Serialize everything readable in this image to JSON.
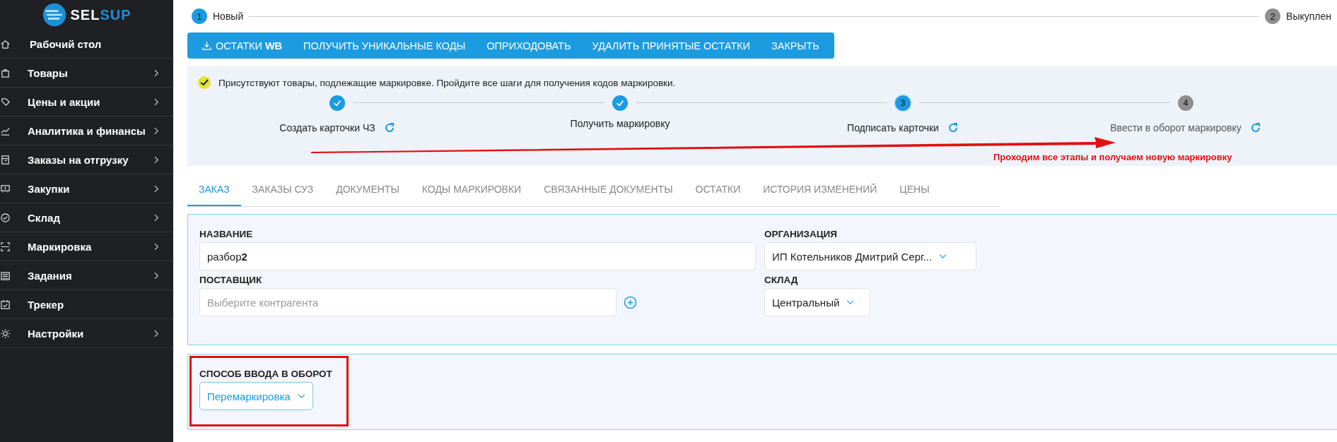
{
  "sidebar": {
    "logo": {
      "text_left": "SEL",
      "text_right": "SUP"
    },
    "items": [
      {
        "label": "Рабочий стол",
        "has_submenu": false
      },
      {
        "label": "Товары",
        "has_submenu": true
      },
      {
        "label": "Цены и акции",
        "has_submenu": true
      },
      {
        "label": "Аналитика и финансы",
        "has_submenu": true
      },
      {
        "label": "Заказы на отгрузку",
        "has_submenu": true
      },
      {
        "label": "Закупки",
        "has_submenu": true
      },
      {
        "label": "Склад",
        "has_submenu": true
      },
      {
        "label": "Маркировка",
        "has_submenu": true
      },
      {
        "label": "Задания",
        "has_submenu": true
      },
      {
        "label": "Трекер",
        "has_submenu": false
      },
      {
        "label": "Настройки",
        "has_submenu": true
      }
    ]
  },
  "status_steps": [
    {
      "number": "1",
      "label": "Новый",
      "selected": true
    },
    {
      "number": "2",
      "label": "Выкуплен",
      "selected": false
    }
  ],
  "toolbar": [
    {
      "label": "ОСТАТКИ **WB**",
      "kind": "download"
    },
    {
      "label": "ПОЛУЧИТЬ УНИКАЛЬНЫЕ КОДЫ",
      "kind": "text"
    },
    {
      "label": "ОПРИХОДОВАТЬ",
      "kind": "text"
    },
    {
      "label": "УДАЛИТЬ ПРИНЯТЫЕ ОСТАТКИ",
      "kind": "text"
    },
    {
      "label": "ЗАКРЫТЬ",
      "kind": "text"
    }
  ],
  "marking": {
    "notice": "Присутствуют товары, подлежащие маркировке. Пройдите все шаги для получения кодов маркировки.",
    "steps": [
      {
        "label": "Создать карточки ЧЗ",
        "completed": true,
        "selected": false,
        "refresh": true
      },
      {
        "label": "Получить маркировку",
        "completed": true,
        "selected": false,
        "refresh": false
      },
      {
        "number": "3",
        "label": "Подписать карточки",
        "completed": false,
        "selected": true,
        "refresh": true
      },
      {
        "number": "4",
        "label": "Ввести в оборот маркировку",
        "completed": false,
        "selected": false,
        "refresh": true
      }
    ]
  },
  "annotation": {
    "text": "Проходим все этапы и получаем новую маркировку"
  },
  "tabs": [
    {
      "label": "ЗАКАЗ",
      "selected": true
    },
    {
      "label": "ЗАКАЗЫ СУЗ",
      "selected": false
    },
    {
      "label": "ДОКУМЕНТЫ",
      "selected": false
    },
    {
      "label": "КОДЫ МАРКИРОВКИ",
      "selected": false
    },
    {
      "label": "СВЯЗАННЫЕ ДОКУМЕНТЫ",
      "selected": false
    },
    {
      "label": "ОСТАТКИ",
      "selected": false
    },
    {
      "label": "ИСТОРИЯ ИЗМЕНЕНИЙ",
      "selected": false
    },
    {
      "label": "ЦЕНЫ",
      "selected": false
    }
  ],
  "form": {
    "name": {
      "label": "НАЗВАНИЕ",
      "value": "разбор**2**"
    },
    "organization": {
      "label": "ОРГАНИЗАЦИЯ",
      "value": "ИП Котельников Дмитрий Серг..."
    },
    "supplier": {
      "label": "ПОСТАВЩИК",
      "placeholder": "Выберите контрагента"
    },
    "warehouse": {
      "label": "СКЛАД",
      "value": "Центральный"
    }
  },
  "entry_method": {
    "label": "СПОСОБ ВВОДА В ОБОРОТ",
    "value": "Перемаркировка"
  }
}
